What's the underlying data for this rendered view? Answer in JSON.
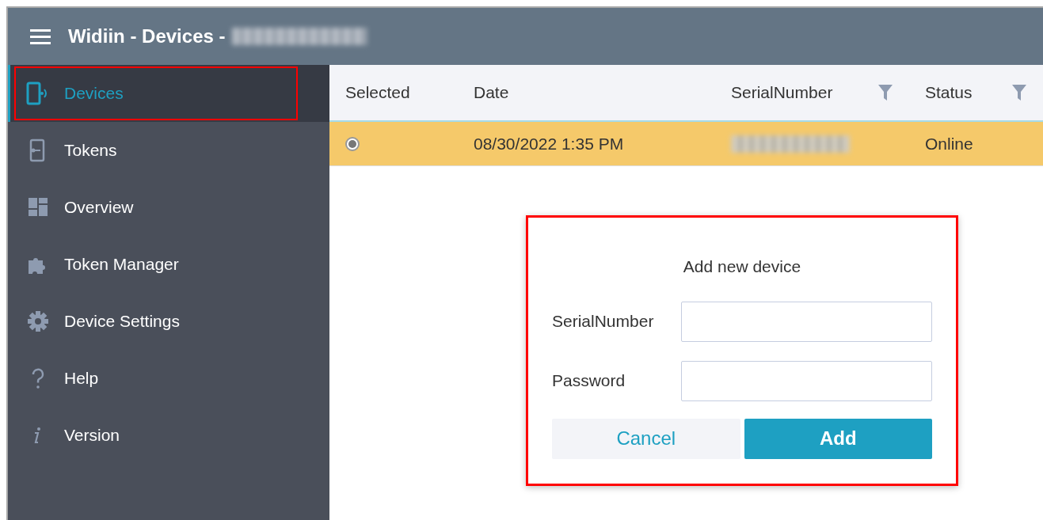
{
  "window": {
    "title": "Widiin - Devices -",
    "title_suffix_blurred": true
  },
  "sidebar": {
    "items": [
      {
        "label": "Devices",
        "selected": true,
        "highlighted": true
      },
      {
        "label": "Tokens",
        "selected": false,
        "highlighted": false
      },
      {
        "label": "Overview",
        "selected": false,
        "highlighted": false
      },
      {
        "label": "Token Manager",
        "selected": false,
        "highlighted": false
      },
      {
        "label": "Device Settings",
        "selected": false,
        "highlighted": false
      },
      {
        "label": "Help",
        "selected": false,
        "highlighted": false
      },
      {
        "label": "Version",
        "selected": false,
        "highlighted": false
      }
    ]
  },
  "table": {
    "columns": [
      {
        "label": "Selected",
        "filter": false
      },
      {
        "label": "Date",
        "filter": false
      },
      {
        "label": "SerialNumber",
        "filter": true
      },
      {
        "label": "Status",
        "filter": true
      }
    ],
    "rows": [
      {
        "selected": true,
        "date": "08/30/2022 1:35 PM",
        "serial_blurred": true,
        "status": "Online"
      }
    ]
  },
  "dialog": {
    "title": "Add new device",
    "highlighted": true,
    "fields": [
      {
        "label": "SerialNumber"
      },
      {
        "label": "Password"
      }
    ],
    "buttons": [
      {
        "label": "Cancel",
        "kind": "secondary"
      },
      {
        "label": "Add",
        "kind": "primary"
      }
    ]
  }
}
